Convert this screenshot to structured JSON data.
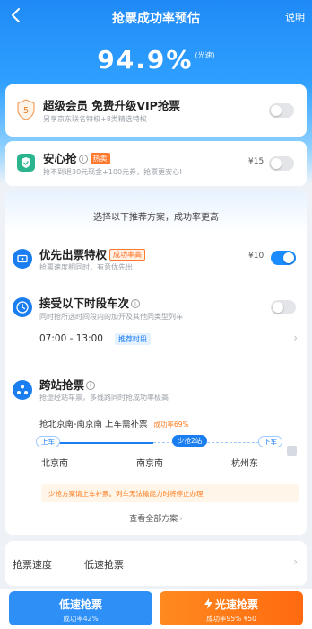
{
  "header": {
    "title": "抢票成功率预估",
    "explain": "说明",
    "rate_value": "94.9%",
    "rate_tag": "(光速)"
  },
  "vip": {
    "title": "超级会员 免费升级VIP抢票",
    "subtitle": "另享京东联名特权+8类精选特权",
    "enabled": false
  },
  "anxin": {
    "title": "安心抢",
    "badge": "热卖",
    "subtitle": "抢不到退30元现金+100元券，抢票更安心!",
    "price": "¥15",
    "enabled": false
  },
  "recommend": {
    "heading": "选择以下推荐方案，成功率更高",
    "priority": {
      "title": "优先出票特权",
      "badge": "成功率高",
      "subtitle": "抢票速度相同时，有意优先出",
      "price": "¥10",
      "enabled": true
    },
    "time_slot": {
      "title": "接受以下时段车次",
      "subtitle": "同时抢所选时间段内的加开及其他同类型列车",
      "range": "07:00 - 13:00",
      "tag": "推荐时段",
      "enabled": false
    },
    "cross": {
      "title": "跨站抢票",
      "subtitle": "抢途经站车票，多线路同时抢成功率极高",
      "plan_text": "抢北京南-南京南 上车需补票",
      "plan_rate": "成功率69%",
      "board_tag": "上车",
      "mid_tag": "少抢2站",
      "alight_tag": "下车",
      "stations": [
        "北京南",
        "南京南",
        "杭州东"
      ],
      "notice": "少抢方案请上车补票。列车无法输能力时将停止办理",
      "view_all": "查看全部方案"
    }
  },
  "speed": {
    "label": "抢票速度",
    "value": "低速抢票"
  },
  "bottom": {
    "low": {
      "label": "低速抢票",
      "sub": "成功率42%"
    },
    "fast": {
      "label": "光速抢票",
      "sub": "成功率95%  ¥50"
    }
  },
  "colors": {
    "brand_blue": "#1a8cff",
    "orange": "#ff7a1a",
    "green": "#2bb58f"
  },
  "icons": [
    "back-arrow-icon",
    "vip-badge-icon",
    "shield-icon",
    "ticket-icon",
    "clock-icon",
    "cross-station-icon",
    "lightning-icon",
    "share-icon"
  ]
}
